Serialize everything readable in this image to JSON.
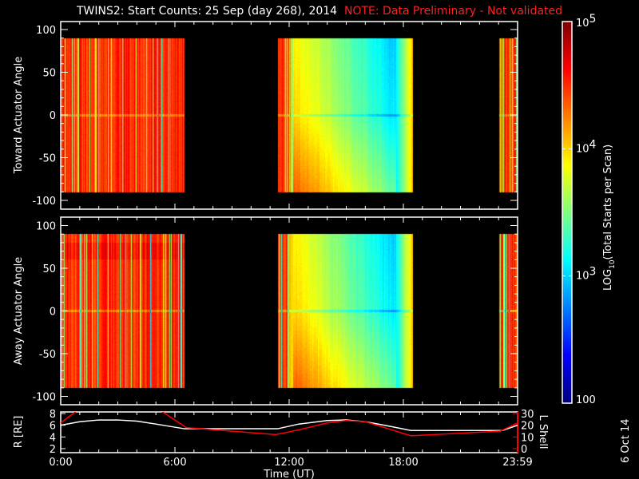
{
  "title": {
    "main": "TWINS2: Start Counts: 25 Sep (day 268), 2014",
    "note": "NOTE: Data Preliminary - Not validated"
  },
  "colors": {
    "note": "#ff2020",
    "r_line": "#ffffff",
    "lshell_line": "#ff0000",
    "frame": "#ffffff"
  },
  "footer_date": "6 Oct 14",
  "chart_data": [
    {
      "type": "heatmap",
      "name": "toward",
      "ylabel": "Toward Actuator Angle",
      "ylim": [
        -110,
        110
      ],
      "yticks": [
        "100",
        "50",
        "0",
        "-50",
        "-100"
      ],
      "ytick_values": [
        100,
        50,
        0,
        -50,
        -100
      ],
      "xlim_hours": [
        0,
        24
      ],
      "angle_range": [
        -90,
        90
      ],
      "data_intervals_hours": [
        [
          0,
          6.5
        ],
        [
          11.4,
          18.5
        ],
        [
          23.0,
          24
        ]
      ],
      "typical_log10_counts": {
        "interval1": 4.5,
        "interval2_start": 4.5,
        "interval2_minimum": 3.0,
        "interval2_end": 4.0,
        "interval3": 4.5
      }
    },
    {
      "type": "heatmap",
      "name": "away",
      "ylabel": "Away Actuator Angle",
      "ylim": [
        -110,
        110
      ],
      "yticks": [
        "100",
        "50",
        "0",
        "-50",
        "-100"
      ],
      "ytick_values": [
        100,
        50,
        0,
        -50,
        -100
      ],
      "xlim_hours": [
        0,
        24
      ],
      "angle_range": [
        -90,
        90
      ],
      "data_intervals_hours": [
        [
          0,
          6.5
        ],
        [
          11.4,
          18.5
        ],
        [
          23.0,
          24
        ]
      ],
      "typical_log10_counts": {
        "interval1": 4.5,
        "interval2_start": 4.5,
        "interval2_minimum": 3.0,
        "interval2_end": 4.0,
        "interval3": 4.5
      }
    },
    {
      "type": "line",
      "name": "orbit",
      "ylabel": "R [RE]",
      "ylabel_right": "L Shell",
      "ylim": [
        1.3,
        8.3
      ],
      "ylim_right": [
        -3.4,
        31.4
      ],
      "yticks": [
        "2",
        "4",
        "6",
        "8"
      ],
      "ytick_values": [
        2,
        4,
        6,
        8
      ],
      "yticks_right": [
        "0",
        "10",
        "20",
        "30"
      ],
      "ytick_values_right": [
        0,
        10,
        20,
        30
      ],
      "xlabel": "Time (UT)",
      "xticks": [
        "0:00",
        "6:00",
        "12:00",
        "18:00",
        "23:59"
      ],
      "xtick_values": [
        0,
        6,
        12,
        18,
        24
      ],
      "series": [
        {
          "name": "R",
          "axis": "left",
          "x": [
            0,
            1,
            2,
            3,
            4,
            5,
            6.5,
            11.4,
            12.5,
            14,
            15,
            16,
            17,
            18.4,
            23.2,
            24
          ],
          "y": [
            6.0,
            6.6,
            6.9,
            6.9,
            6.7,
            6.2,
            5.4,
            5.4,
            6.2,
            6.8,
            6.9,
            6.6,
            6.0,
            5.1,
            5.1,
            6.0
          ]
        },
        {
          "name": "L Shell",
          "axis": "right",
          "x": [
            0,
            0.9,
            5.2,
            6.6,
            11.3,
            12.5,
            14,
            15,
            16,
            17,
            18.4,
            23.1,
            24
          ],
          "y": [
            22,
            33,
            33,
            18,
            12,
            16,
            22,
            24,
            23,
            18,
            11,
            15,
            22
          ]
        }
      ]
    }
  ],
  "colorbar": {
    "label": "LOG10(Total Starts per Scan)",
    "label_prefix": "LOG",
    "label_sub": "10",
    "label_suffix": "(Total Starts per Scan)",
    "ticks": [
      "100",
      "10",
      "10",
      "10"
    ],
    "tick_exponents": [
      "",
      "3",
      "4",
      "5"
    ],
    "tick_values_log10": [
      2,
      3,
      4,
      5
    ],
    "range_log10": [
      2,
      5
    ],
    "colormap": "jet"
  }
}
